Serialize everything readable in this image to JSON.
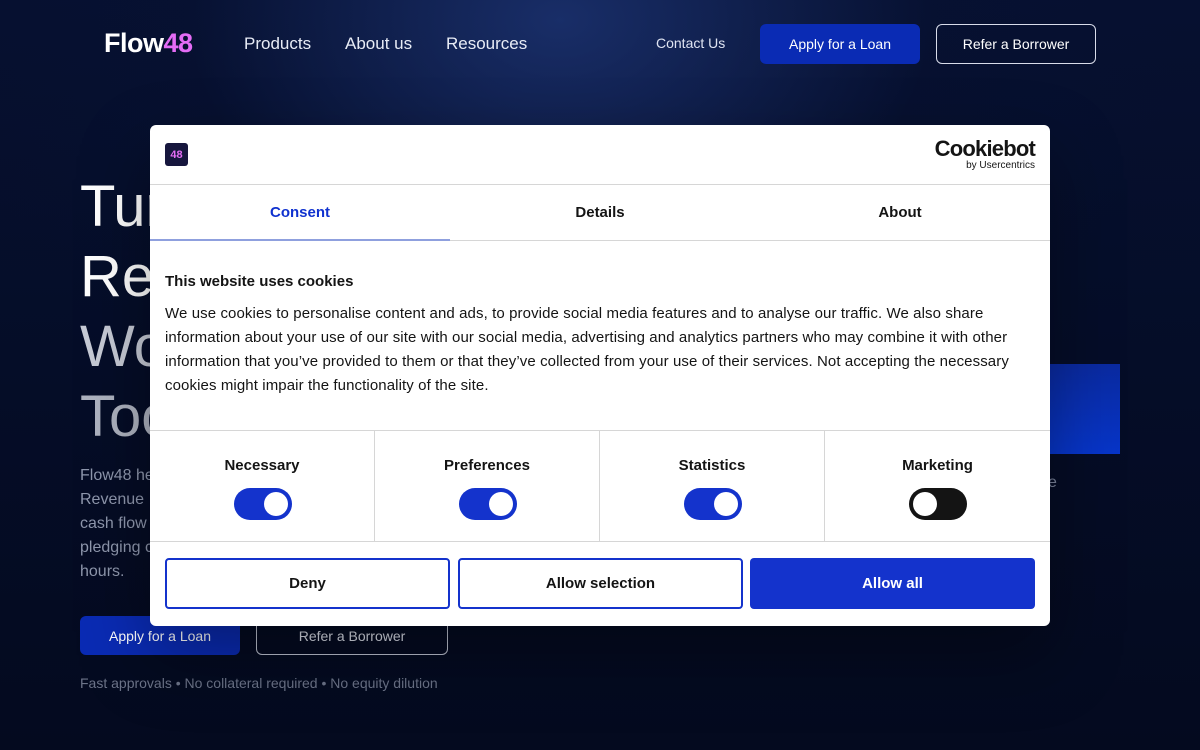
{
  "header": {
    "logo_text": "Flow",
    "logo_num": "48",
    "nav": [
      "Products",
      "About us",
      "Resources"
    ],
    "contact": "Contact Us",
    "apply": "Apply for a Loan",
    "refer": "Refer a Borrower"
  },
  "hero": {
    "title_lines": [
      "Tur",
      "Re",
      "Wo",
      "Too"
    ],
    "desc": "Flow48 he\nRevenue\ncash flow\npledging c\nhours.",
    "apply": "Apply for a Loan",
    "refer": "Refer a Borrower",
    "foot": "Fast approvals • No collateral required • No equity dilution",
    "side_text": "e"
  },
  "dialog": {
    "small_logo": "48",
    "brand": "Cookiebot",
    "brand_sub": "by Usercentrics",
    "tabs": [
      {
        "label": "Consent",
        "active": true
      },
      {
        "label": "Details",
        "active": false
      },
      {
        "label": "About",
        "active": false
      }
    ],
    "title": "This website uses cookies",
    "text": "We use cookies to personalise content and ads, to provide social media features and to analyse our traffic. We also share information about your use of our site with our social media, advertising and analytics partners who may combine it with other information that you’ve provided to them or that they’ve collected from your use of their services. Not accepting the necessary cookies might impair the functionality of the site.",
    "toggles": [
      {
        "label": "Necessary",
        "on": true
      },
      {
        "label": "Preferences",
        "on": true
      },
      {
        "label": "Statistics",
        "on": true
      },
      {
        "label": "Marketing",
        "on": false
      }
    ],
    "buttons": {
      "deny": "Deny",
      "allow_selection": "Allow selection",
      "allow_all": "Allow all"
    }
  },
  "colors": {
    "accent": "#1433cc",
    "brand_blue": "#0a2bb4",
    "logo_pink": "#e46cf5",
    "background": "#040a1f"
  }
}
